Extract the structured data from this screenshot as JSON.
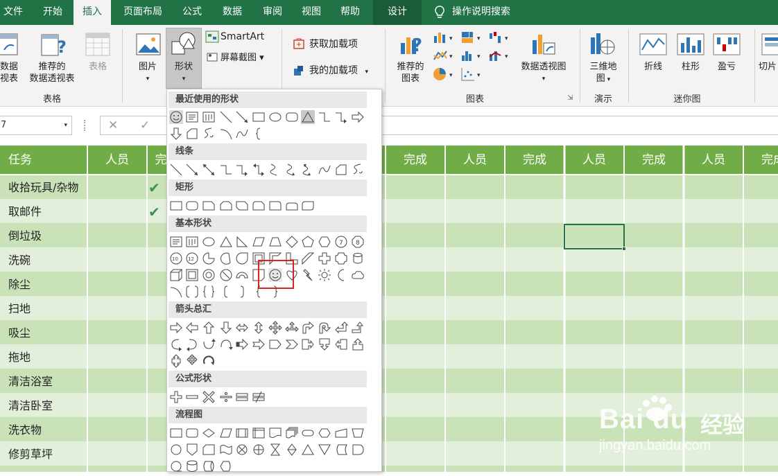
{
  "tabs": [
    {
      "label": "文件"
    },
    {
      "label": "开始"
    },
    {
      "label": "插入"
    },
    {
      "label": "页面布局"
    },
    {
      "label": "公式"
    },
    {
      "label": "数据"
    },
    {
      "label": "审阅"
    },
    {
      "label": "视图"
    },
    {
      "label": "帮助"
    },
    {
      "label": "设计"
    }
  ],
  "tell_me": "操作说明搜索",
  "ribbon": {
    "pivot_line1": "数据",
    "pivot_line2": "视表",
    "recommended_pivot_line1": "推荐的",
    "recommended_pivot_line2": "数据透视表",
    "table": "表格",
    "group_tables": "表格",
    "picture": "图片",
    "shapes": "形状",
    "smartart": "SmartArt",
    "screenshot": "屏幕截图",
    "get_addins": "获取加载项",
    "my_addins": "我的加载项",
    "recommended_charts_line1": "推荐的",
    "recommended_charts_line2": "图表",
    "pivot_chart": "数据透视图",
    "group_charts": "图表",
    "map3d_line1": "三维地",
    "map3d_line2": "图",
    "group_tours": "演示",
    "spark_line": "折线",
    "spark_column": "柱形",
    "spark_winloss": "盈亏",
    "group_sparklines": "迷你图",
    "slicer": "切片"
  },
  "formula_bar": {
    "name_box": "7",
    "cancel": "✕",
    "enter": "✓"
  },
  "sheet": {
    "headers": [
      "任务",
      "人员",
      "完",
      "完成",
      "人员",
      "完成",
      "人员",
      "完成",
      "人员",
      "完成"
    ],
    "tasks": [
      "收拾玩具/杂物",
      "取邮件",
      "倒垃圾",
      "洗碗",
      "除尘",
      "扫地",
      "吸尘",
      "拖地",
      "清洁浴室",
      "清洁卧室",
      "洗衣物",
      "修剪草坪"
    ],
    "check": "✔"
  },
  "shapes_panel": {
    "sections": [
      "最近使用的形状",
      "线条",
      "矩形",
      "基本形状",
      "箭头总汇",
      "公式形状",
      "流程图"
    ]
  },
  "watermark": {
    "brand": "Bai du",
    "cn": "经验",
    "url": "jingyan.baidu.com"
  },
  "colors": {
    "excel_green": "#217346",
    "header_green": "#70ad47",
    "band_light": "#e2efda",
    "highlight_red": "#e02020"
  }
}
